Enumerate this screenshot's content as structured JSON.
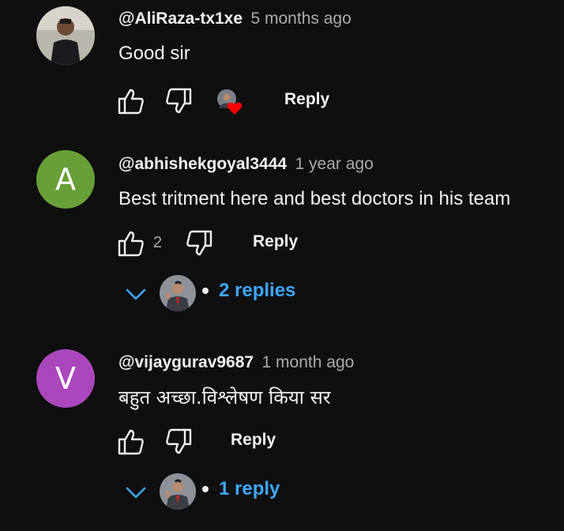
{
  "comments": [
    {
      "author": "@AliRaza-tx1xe",
      "time": "5 months ago",
      "text": "Good sir",
      "reply_label": "Reply",
      "avatar_type": "photo"
    },
    {
      "author": "@abhishekgoyal3444",
      "time": "1 year ago",
      "text": "Best tritment here and best doctors in his team",
      "like_count": "2",
      "reply_label": "Reply",
      "avatar_letter": "A",
      "avatar_color": "#689f38",
      "replies_label": "2 replies"
    },
    {
      "author": "@vijaygurav9687",
      "time": "1 month ago",
      "text": "बहुत अच्छा.विश्लेषण किया सर",
      "reply_label": "Reply",
      "avatar_letter": "V",
      "avatar_color": "#ab47bc",
      "replies_label": "1 reply"
    }
  ],
  "colors": {
    "background": "#0f0f0f",
    "link_blue": "#3ea6ff",
    "heart_red": "#ff0000",
    "muted_text": "#aaaaaa"
  },
  "icons": [
    "like-icon",
    "dislike-icon",
    "heart-icon",
    "chevron-down-icon"
  ]
}
